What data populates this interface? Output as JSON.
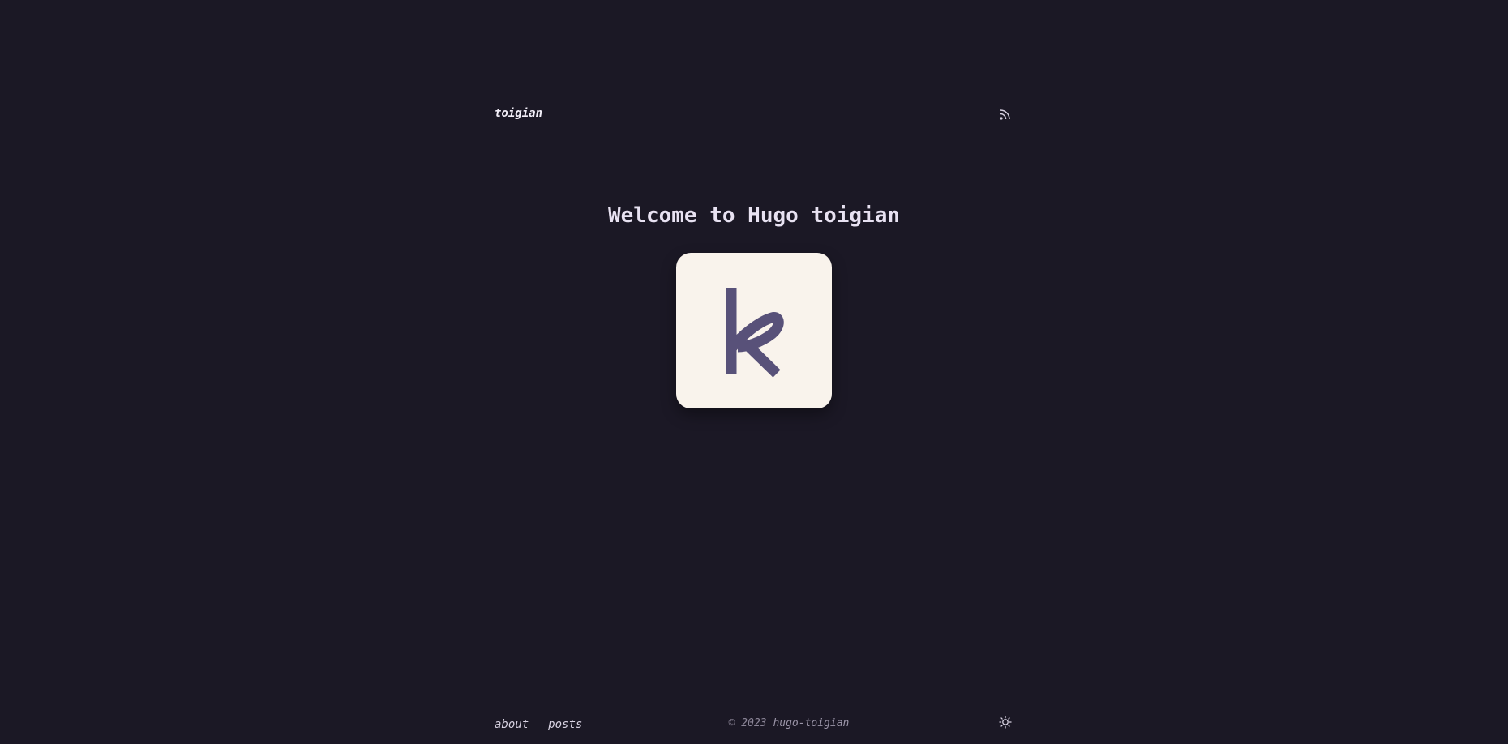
{
  "header": {
    "site_title": "toigian",
    "rss_icon": "rss-icon"
  },
  "hero": {
    "title": "Welcome to Hugo toigian",
    "logo_glyph": "k",
    "logo_background": "#f9f3ec",
    "logo_glyph_color": "#585179"
  },
  "footer": {
    "nav": [
      {
        "label": "about"
      },
      {
        "label": "posts"
      }
    ],
    "copyright_prefix": "© 2023",
    "copyright_owner": "hugo-toigian",
    "theme_toggle_icon": "sun-icon"
  },
  "colors": {
    "background": "#1b1825",
    "text": "#e8e4f0",
    "muted": "#8a8496"
  }
}
